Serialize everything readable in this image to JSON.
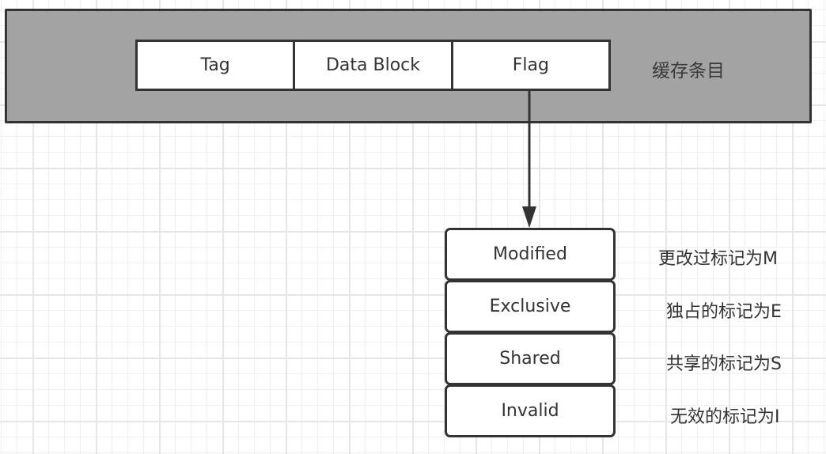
{
  "cache_entry": {
    "label": "缓存条目",
    "fields": [
      {
        "label": "Tag"
      },
      {
        "label": "Data Block"
      },
      {
        "label": "Flag"
      }
    ]
  },
  "flag_states": [
    {
      "label": "Modified",
      "note": "更改过标记为M"
    },
    {
      "label": "Exclusive",
      "note": "独占的标记为E"
    },
    {
      "label": "Shared",
      "note": "共享的标记为S"
    },
    {
      "label": "Invalid",
      "note": "无效的标记为I"
    }
  ],
  "colors": {
    "entry_fill": "#a3a3a3",
    "stroke": "#333333",
    "box_fill": "#ffffff"
  }
}
